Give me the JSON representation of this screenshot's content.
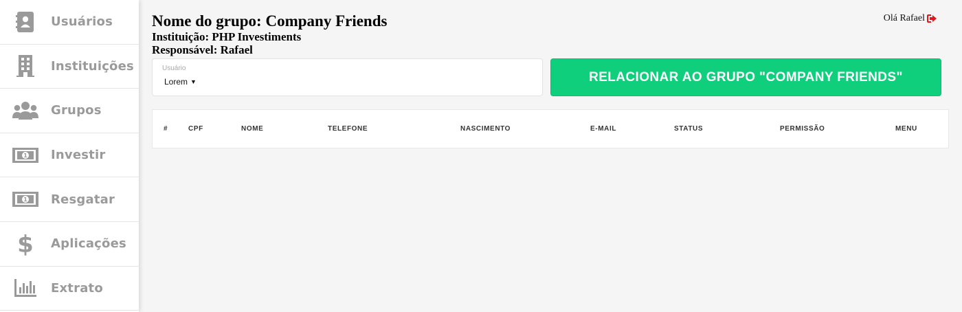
{
  "sidebar": {
    "items": [
      {
        "label": "Usuários",
        "icon": "address-book-icon"
      },
      {
        "label": "Instituições",
        "icon": "building-icon"
      },
      {
        "label": "Grupos",
        "icon": "users-icon"
      },
      {
        "label": "Investir",
        "icon": "money-bill-icon"
      },
      {
        "label": "Resgatar",
        "icon": "money-bill-icon"
      },
      {
        "label": "Aplicações",
        "icon": "dollar-icon"
      },
      {
        "label": "Extrato",
        "icon": "bar-chart-icon"
      }
    ]
  },
  "user": {
    "greeting": "Olá Rafael",
    "logout_icon": "sign-out-icon",
    "logout_color": "#e8141b"
  },
  "group": {
    "title": "Nome do grupo: Company Friends",
    "institution": "Instituição: PHP Investiments",
    "responsible": "Responsável: Rafael"
  },
  "form": {
    "select_label": "Usuário",
    "select_value": "Lorem",
    "relate_button": "RELACIONAR AO GRUPO \"COMPANY FRIENDS\"",
    "button_color": "#0fce7c"
  },
  "table": {
    "columns": [
      "#",
      "CPF",
      "NOME",
      "TELEFONE",
      "NASCIMENTO",
      "E-MAIL",
      "STATUS",
      "PERMISSÃO",
      "MENU"
    ]
  }
}
